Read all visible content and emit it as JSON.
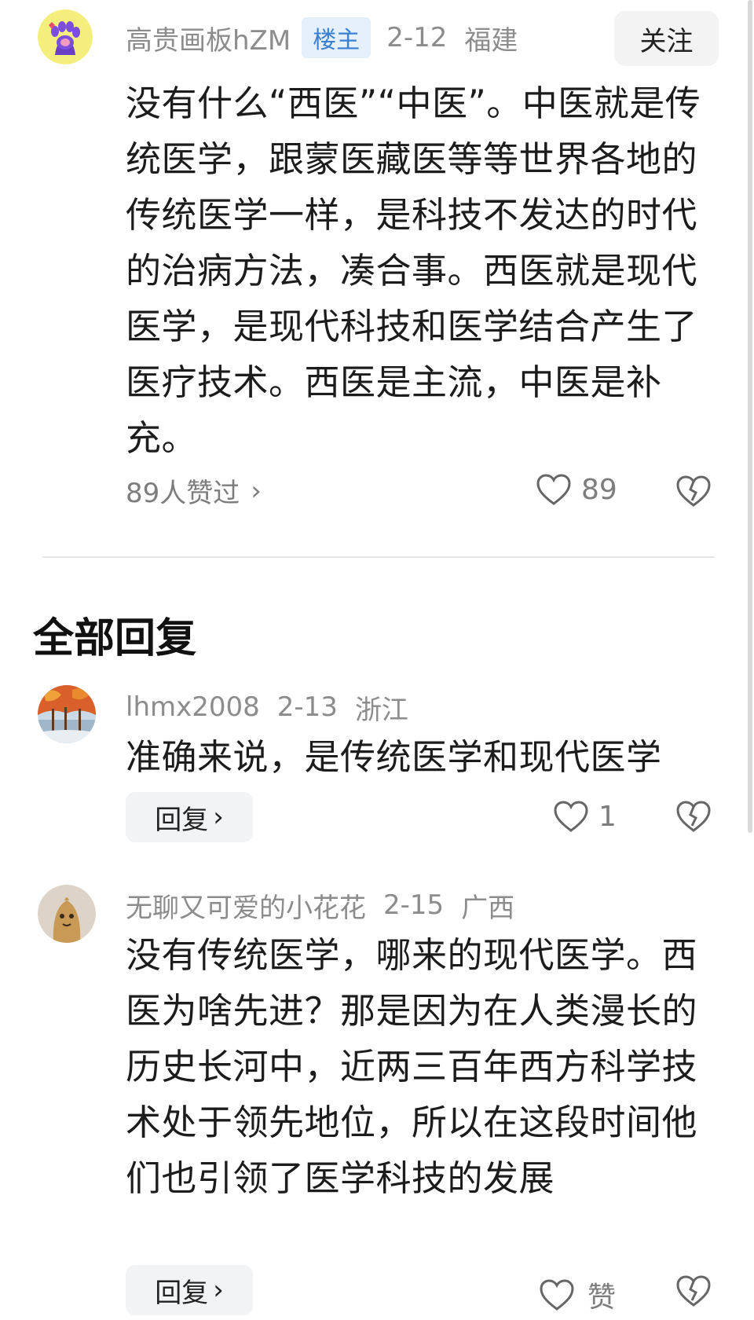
{
  "main_post": {
    "username": "高贵画板hZM",
    "badge": "楼主",
    "date": "2-12",
    "location": "福建",
    "follow_label": "关注",
    "text": "没有什么“西医”“中医”。中医就是传统医学，跟蒙医藏医等等世界各地的传统医学一样，是科技不发达的时代的治病方法，凑合事。西医就是现代医学，是现代科技和医学结合产生了医疗技术。西医是主流，中医是补充。",
    "likes_summary": "89人赞过",
    "like_count": "89",
    "avatar_icon": "paw-avatar-icon"
  },
  "replies_section": {
    "title": "全部回复"
  },
  "replies": [
    {
      "username": "lhmx2008",
      "date": "2-13",
      "location": "浙江",
      "text": "准确来说，是传统医学和现代医学",
      "reply_label": "回复",
      "like_count": "1",
      "avatar_icon": "autumn-trees-avatar-icon"
    },
    {
      "username": "无聊又可爱的小花花",
      "date": "2-15",
      "location": "广西",
      "text": "没有传统医学，哪来的现代医学。西医为啥先进？那是因为在人类漫长的历史长河中，近两三百年西方科学技术处于领先地位，所以在这段时间他们也引领了医学科技的发展",
      "reply_label": "回复",
      "like_count": "赞",
      "avatar_icon": "cartoon-bean-avatar-icon"
    }
  ],
  "colors": {
    "meta_gray": "#8c8c8c",
    "badge_bg": "#e6f0fb",
    "badge_text": "#3a7fd0",
    "button_bg": "#f2f3f5"
  }
}
